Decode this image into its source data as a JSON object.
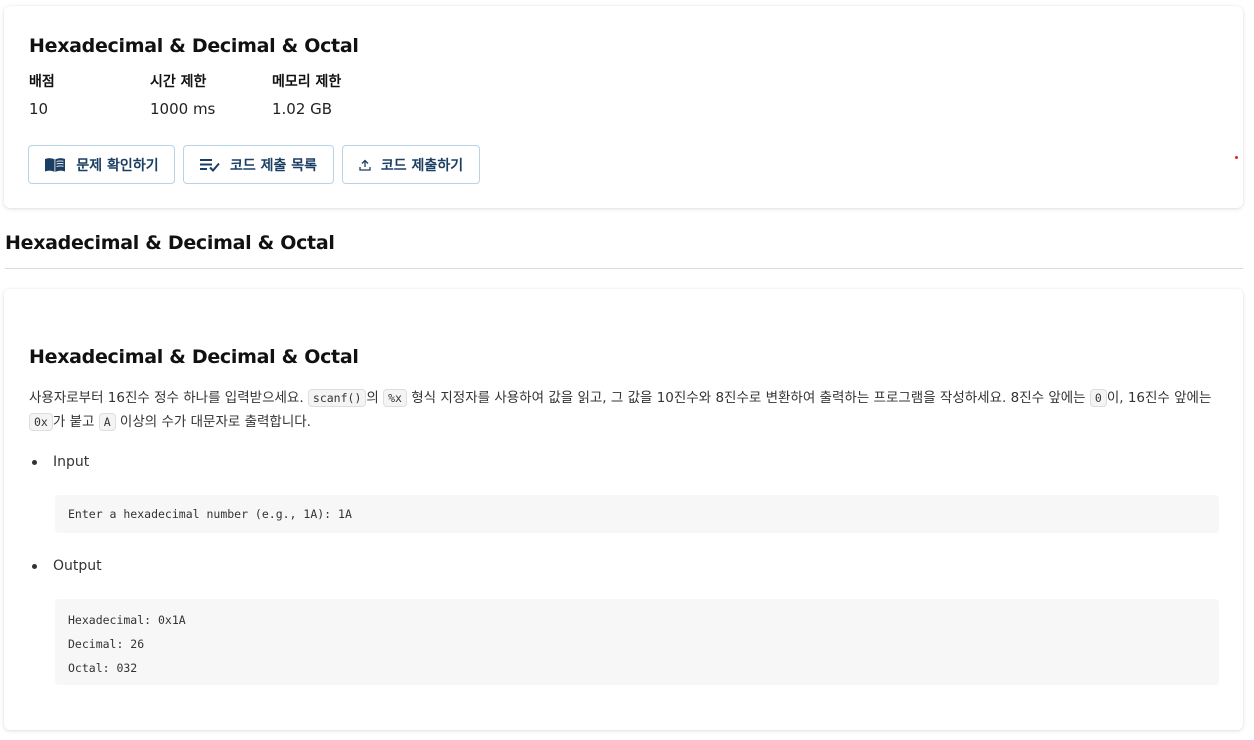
{
  "header": {
    "title": "Hexadecimal & Decimal & Octal",
    "meta": [
      {
        "label": "배점",
        "value": "10"
      },
      {
        "label": "시간 제한",
        "value": "1000 ms"
      },
      {
        "label": "메모리 제한",
        "value": "1.02 GB"
      }
    ],
    "buttons": {
      "view_problem": "문제 확인하기",
      "submission_list": "코드 제출 목록",
      "submit_code": "코드 제출하기"
    }
  },
  "section_heading": "Hexadecimal & Decimal & Octal",
  "content": {
    "title": "Hexadecimal & Decimal & Octal",
    "desc": {
      "p1": "사용자로부터 16진수 정수 하나를 입력받으세요. ",
      "c1": "scanf()",
      "p2": "의 ",
      "c2": "%x",
      "p3": " 형식 지정자를 사용하여 값을 읽고, 그 값을 10진수와 8진수로 변환하여 출력하는 프로그램을 작성하세요. 8진수 앞에는 ",
      "c3": "0",
      "p4": "이, 16진수 앞에는 ",
      "c4": "0x",
      "p5": "가 붙고 ",
      "c5": "A",
      "p6": " 이상의 수가 대문자로 출력합니다."
    },
    "input_label": "Input",
    "input_code": "Enter a hexadecimal number (e.g., 1A): 1A",
    "output_label": "Output",
    "output_lines": [
      "Hexadecimal: 0x1A",
      "Decimal: 26",
      "Octal: 032"
    ]
  },
  "colors": {
    "button_border": "#b9d3e6",
    "button_text": "#1b3f63",
    "code_bg": "#f7f7f7"
  }
}
